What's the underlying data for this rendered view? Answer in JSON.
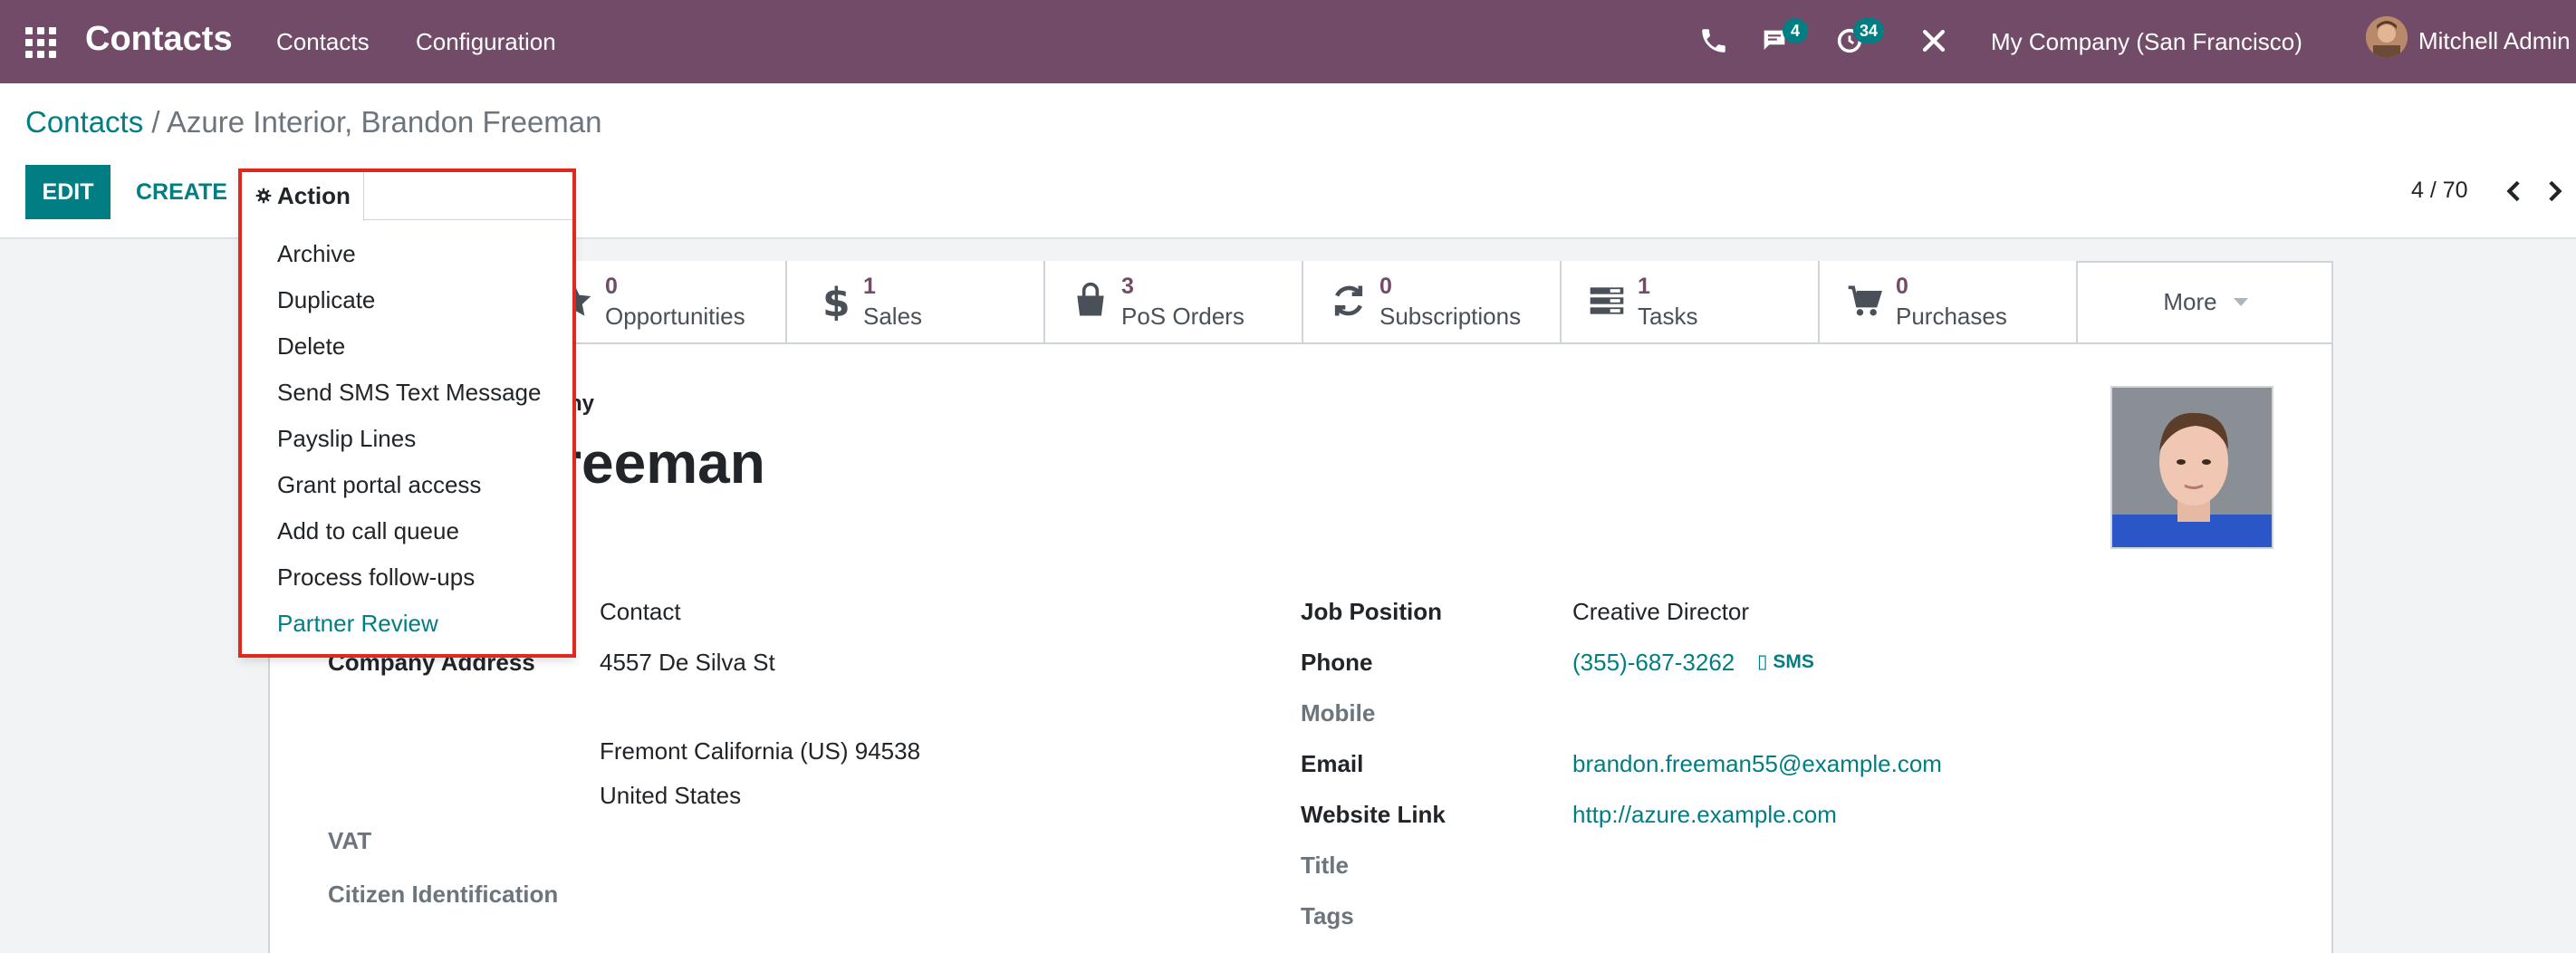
{
  "topbar": {
    "app_name": "Contacts",
    "menu": [
      "Contacts",
      "Configuration"
    ],
    "messages_badge": "4",
    "activities_badge": "34",
    "company": "My Company (San Francisco)",
    "user": "Mitchell Admin",
    "bar_color": "#714b67"
  },
  "breadcrumb": {
    "root": "Contacts",
    "separator": " / ",
    "current": "Azure Interior, Brandon Freeman"
  },
  "toolbar": {
    "edit_label": "EDIT",
    "create_label": "CREATE",
    "action_label": "Action",
    "pager": "4 / 70"
  },
  "action_menu": {
    "items": [
      "Archive",
      "Duplicate",
      "Delete",
      "Send SMS Text Message",
      "Payslip Lines",
      "Grant portal access",
      "Add to call queue",
      "Process follow-ups",
      "Partner Review"
    ]
  },
  "smart_buttons": [
    {
      "value": "0",
      "label": "Opportunities",
      "icon": "star-icon"
    },
    {
      "value": "1",
      "label": "Sales",
      "icon": "dollar-icon"
    },
    {
      "value": "3",
      "label": "PoS Orders",
      "icon": "shopping-bag-icon"
    },
    {
      "value": "0",
      "label": "Subscriptions",
      "icon": "refresh-icon"
    },
    {
      "value": "1",
      "label": "Tasks",
      "icon": "tasks-icon"
    },
    {
      "value": "0",
      "label": "Purchases",
      "icon": "cart-icon"
    }
  ],
  "more_label": "More",
  "partner": {
    "company_type_fragment": "pany",
    "name_fragment": "Freeman"
  },
  "left_fields": {
    "type_value": "Contact",
    "address_label": "Company Address",
    "street": "4557 De Silva St",
    "city_line": "Fremont  California (US)  94538",
    "country": "United States",
    "vat_label": "VAT",
    "citizen_label": "Citizen Identification"
  },
  "right_fields": {
    "job_label": "Job Position",
    "job_value": "Creative Director",
    "phone_label": "Phone",
    "phone_value": "(355)-687-3262",
    "sms_label": "SMS",
    "mobile_label": "Mobile",
    "email_label": "Email",
    "email_value": "brandon.freeman55@example.com",
    "website_label": "Website Link",
    "website_value": "http://azure.example.com",
    "title_label": "Title",
    "tags_label": "Tags"
  }
}
